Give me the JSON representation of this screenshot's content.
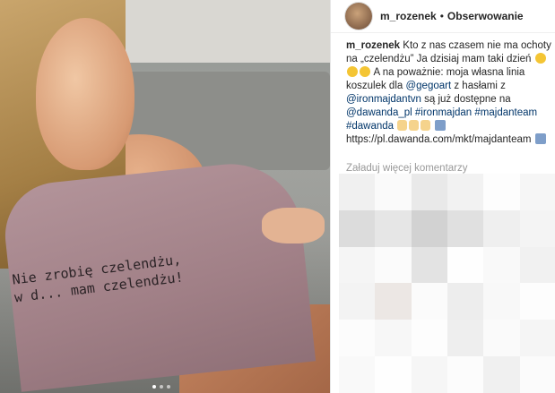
{
  "post": {
    "username": "m_rozenek",
    "separator": "•",
    "follow_label": "Obserwowanie"
  },
  "photo": {
    "shirt_line1": "Nie zrobię czelendżu,",
    "shirt_line2": "w d... mam czelendżu!",
    "carousel_dots": 3,
    "active_dot": 1
  },
  "caption": {
    "username": "m_rozenek",
    "text1": " Kto z nas czasem nie ma ochoty na „czelendżu” Ja dzisiaj mam taki dzień ",
    "text2": " A na poważnie: moja własna linia koszulek dla ",
    "mention1": "@gegoart",
    "text3": " z hasłami z ",
    "mention2": "@ironmajdantvn",
    "text4": " są już dostępne na ",
    "mention3": "@dawanda_pl",
    "tag1": "#ironmajdan",
    "tag2": "#majdanteam",
    "tag3": "#dawanda",
    "url": "https://pl.dawanda.com/mkt/majdanteam"
  },
  "load_more": "Załaduj więcej komentarzy",
  "blur_colors": [
    "#f0f0f0",
    "#fafafa",
    "#e9e9e9",
    "#f2f2f2",
    "#fdfdfd",
    "#f6f6f6",
    "#dcdcdc",
    "#e6e6e6",
    "#d2d2d2",
    "#e0e0e0",
    "#efefef",
    "#f4f4f4",
    "#f5f5f5",
    "#fbfbfb",
    "#e3e3e3",
    "#fefefe",
    "#f9f9f9",
    "#f1f1f1",
    "#f3f3f3",
    "#ece7e4",
    "#fbfbfb",
    "#ededed",
    "#f8f8f8",
    "#fdfdfd",
    "#fcfcfc",
    "#f7f7f7",
    "#fdfdfd",
    "#eeeeee",
    "#fafafa",
    "#f5f5f5",
    "#f9f9f9",
    "#fefefe",
    "#f6f6f6",
    "#fcfcfc",
    "#f0f0f0",
    "#fbfbfb"
  ]
}
